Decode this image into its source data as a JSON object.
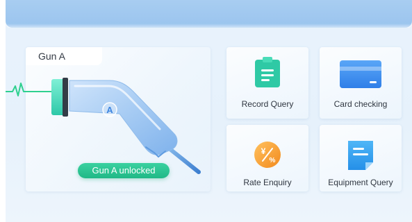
{
  "gun_panel": {
    "title": "Gun A",
    "gun_badge": "A",
    "status": "Gun A unlocked"
  },
  "tiles": [
    {
      "label": "Record Query",
      "icon": "clipboard-icon"
    },
    {
      "label": "Card checking",
      "icon": "card-icon"
    },
    {
      "label": "Rate Enquiry",
      "icon": "rate-icon",
      "icon_text": "¥/%"
    },
    {
      "label": "Equipment Query",
      "icon": "document-icon"
    }
  ],
  "colors": {
    "top_bar": "#9ac4ee",
    "status_green": "#20b886",
    "record_icon": "#2fc9a5",
    "card_icon": "#3b8cf2",
    "rate_icon": "#f39a2c",
    "equipment_icon": "#2d9ef0"
  }
}
